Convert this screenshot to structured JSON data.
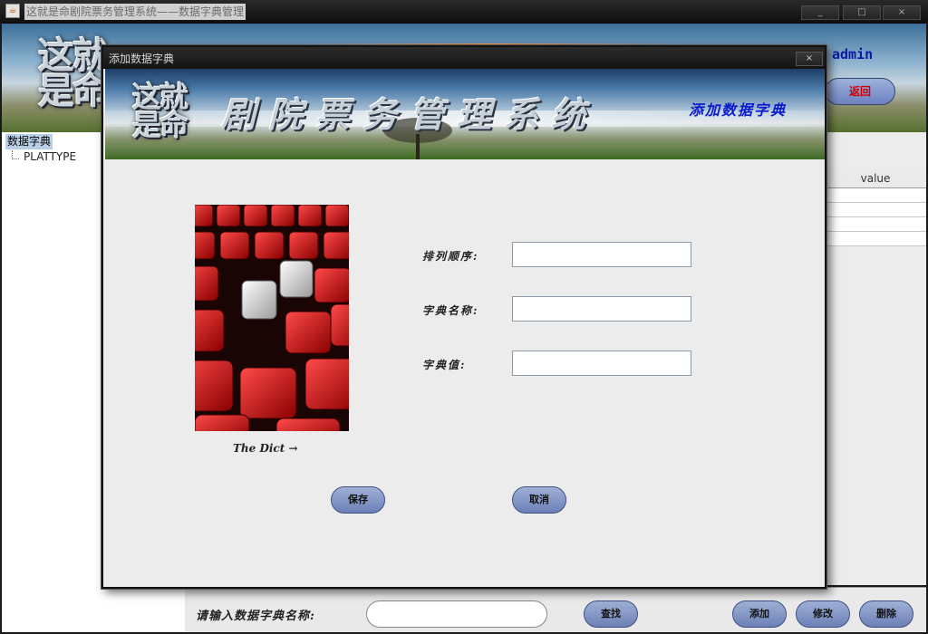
{
  "window": {
    "title": "这就是命剧院票务管理系统——数据字典管理",
    "app_icon": "java-cup-icon",
    "controls": {
      "minimize": "_",
      "maximize": "□",
      "close": "×"
    }
  },
  "main": {
    "logo_lines": [
      "这就",
      "是命"
    ],
    "user": "admin",
    "return_label": "返回",
    "tree": {
      "root": "数据字典",
      "children": [
        "PLATTYPE"
      ]
    },
    "table": {
      "columns": [
        "value"
      ],
      "row_count": 4
    },
    "search": {
      "label": "请输入数据字典名称:",
      "value": "",
      "find_label": "查找",
      "add_label": "添加",
      "edit_label": "修改",
      "delete_label": "删除"
    }
  },
  "dialog": {
    "title": "添加数据字典",
    "close_label": "×",
    "banner": {
      "logo_lines": [
        "这就",
        "是命"
      ],
      "title": "剧院票务管理系统",
      "subtitle": "添加数据字典"
    },
    "poster_caption": "The Dict →",
    "fields": [
      {
        "label": "排列顺序:",
        "value": ""
      },
      {
        "label": "字典名称:",
        "value": ""
      },
      {
        "label": "字典值:",
        "value": ""
      }
    ],
    "save_label": "保存",
    "cancel_label": "取消"
  }
}
